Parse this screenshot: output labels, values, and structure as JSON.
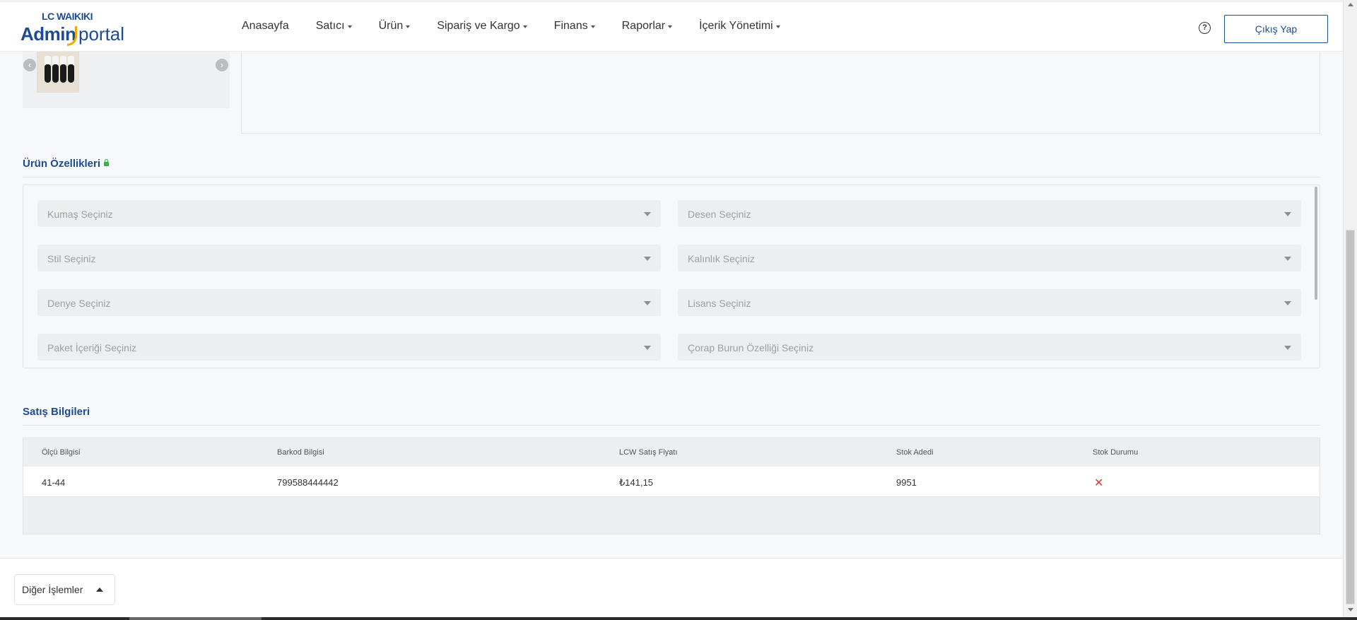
{
  "header": {
    "logo_brand": "LC WAIKIKI",
    "logo_admin": "Admin",
    "logo_portal": "portal",
    "nav": [
      {
        "label": "Anasayfa",
        "dropdown": false
      },
      {
        "label": "Satıcı",
        "dropdown": true
      },
      {
        "label": "Ürün",
        "dropdown": true
      },
      {
        "label": "Sipariş ve Kargo",
        "dropdown": true
      },
      {
        "label": "Finans",
        "dropdown": true
      },
      {
        "label": "Raporlar",
        "dropdown": true
      },
      {
        "label": "İçerik Yönetimi",
        "dropdown": true
      }
    ],
    "help_glyph": "?",
    "logout_label": "Çıkış Yap"
  },
  "carousel": {
    "prev_glyph": "‹",
    "next_glyph": "›"
  },
  "product_features": {
    "title": "Ürün Özellikleri",
    "fields": [
      {
        "placeholder": "Kumaş Seçiniz"
      },
      {
        "placeholder": "Desen Seçiniz"
      },
      {
        "placeholder": "Stil Seçiniz"
      },
      {
        "placeholder": "Kalınlık Seçiniz"
      },
      {
        "placeholder": "Denye Seçiniz"
      },
      {
        "placeholder": "Lisans Seçiniz"
      },
      {
        "placeholder": "Paket İçeriği Seçiniz"
      },
      {
        "placeholder": "Çorap Burun Özelliği Seçiniz"
      }
    ]
  },
  "sales_info": {
    "title": "Satış Bilgileri",
    "columns": [
      "Ölçü Bilgisi",
      "Barkod Bilgisi",
      "LCW Satış Fiyatı",
      "Stok Adedi",
      "Stok Durumu"
    ],
    "rows": [
      {
        "size": "41-44",
        "barcode": "799588444442",
        "price": "₺141,15",
        "stock": "9951",
        "status_glyph": "✕"
      }
    ]
  },
  "bottom": {
    "other_actions_label": "Diğer İşlemler"
  },
  "colors": {
    "brand": "#1d4b94",
    "accent": "#f2a900",
    "error": "#e4342a",
    "lock": "#2fb34a"
  }
}
